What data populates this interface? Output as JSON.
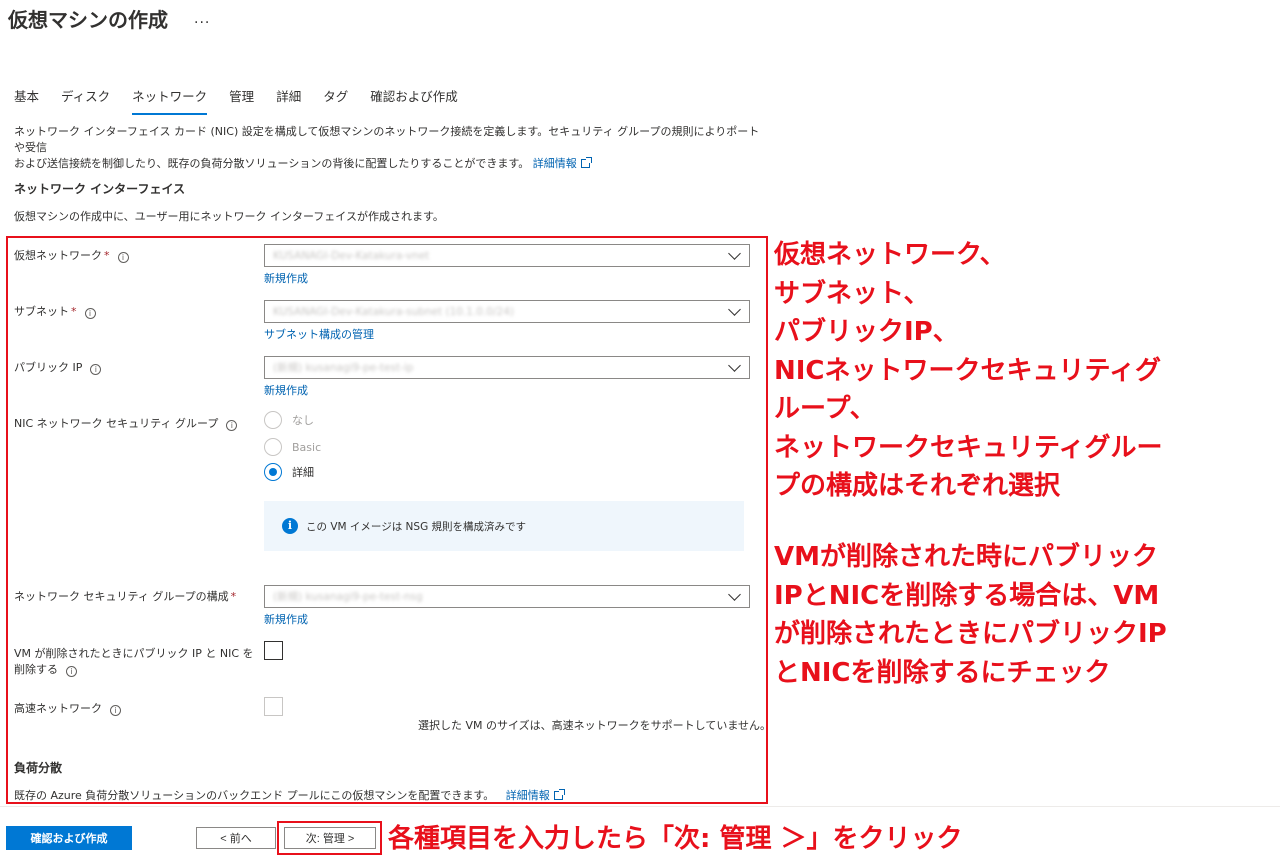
{
  "header": {
    "title": "仮想マシンの作成",
    "more": "···"
  },
  "tabs": [
    {
      "label": "基本"
    },
    {
      "label": "ディスク"
    },
    {
      "label": "ネットワーク"
    },
    {
      "label": "管理"
    },
    {
      "label": "詳細"
    },
    {
      "label": "タグ"
    },
    {
      "label": "確認および作成"
    }
  ],
  "intro": {
    "line1": "ネットワーク インターフェイス カード (NIC) 設定を構成して仮想マシンのネットワーク接続を定義します。セキュリティ グループの規則によりポートや受信",
    "line2": "および送信接続を制御したり、既存の負荷分散ソリューションの背後に配置したりすることができます。",
    "link": "詳細情報"
  },
  "nic_section": {
    "heading": "ネットワーク インターフェイス",
    "description": "仮想マシンの作成中に、ユーザー用にネットワーク インターフェイスが作成されます。"
  },
  "form": {
    "vnet": {
      "label": "仮想ネットワーク",
      "value": "KUSANAGI-Dev-Katakura-vnet",
      "link": "新規作成"
    },
    "subnet": {
      "label": "サブネット",
      "value": "KUSANAGI-Dev-Katakura-subnet (10.1.0.0/24)",
      "link": "サブネット構成の管理"
    },
    "public_ip": {
      "label": "パブリック IP",
      "value": "(新規) kusanagi9-pe-test-ip",
      "link": "新規作成"
    },
    "nic_nsg": {
      "label": "NIC ネットワーク セキュリティ グループ",
      "options": [
        "なし",
        "Basic",
        "詳細"
      ],
      "selected": "詳細"
    },
    "info_message": "この VM イメージは NSG 規則を構成済みです",
    "nsg_config": {
      "label": "ネットワーク セキュリティ グループの構成",
      "value": "(新規) kusanagi9-pe-test-nsg",
      "link": "新規作成"
    },
    "delete_with_vm": {
      "label_line1": "VM が削除されたときにパブリック IP と NIC を",
      "label_line2": "削除する",
      "checked": false
    },
    "accelerated": {
      "label": "高速ネットワーク",
      "checked": false,
      "note": "選択した VM のサイズは、高速ネットワークをサポートしていません。"
    }
  },
  "lb_section": {
    "heading": "負荷分散",
    "description": "既存の Azure 負荷分散ソリューションのバックエンド プールにこの仮想マシンを配置できます。",
    "link": "詳細情報"
  },
  "annotations": {
    "note1": [
      "仮想ネットワーク、",
      "サブネット、",
      "パブリックIP、",
      "NICネットワークセキュリティグ",
      "ループ、",
      "ネットワークセキュリティグルー",
      "プの構成はそれぞれ選択"
    ],
    "note2": [
      "VMが削除された時にパブリック",
      "IPとNICを削除する場合は、VM",
      "が削除されたときにパブリックIP",
      "とNICを削除するにチェック"
    ],
    "note3": "各種項目を入力したら「次: 管理 ＞」をクリック"
  },
  "footer": {
    "review_create": "確認および作成",
    "previous": "< 前へ",
    "next": "次: 管理 >"
  },
  "colors": {
    "accent": "#0078d4",
    "annotation": "#e8101b"
  }
}
